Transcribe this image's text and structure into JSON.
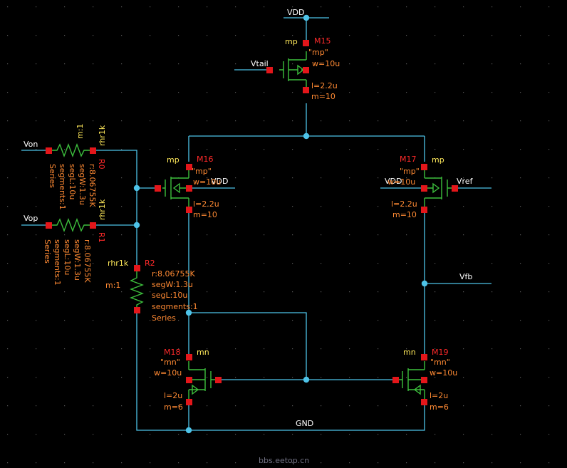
{
  "nets": {
    "vdd": "VDD",
    "vtail": "Vtail",
    "von": "Von",
    "vop": "Vop",
    "vref": "Vref",
    "vfb": "Vfb",
    "gnd": "GND",
    "vdd_m16": "VDD",
    "vdd_m17": "VDD"
  },
  "devices": {
    "m15": {
      "type": "mp",
      "name": "M15",
      "model": "\"mp\"",
      "w": "w=10u",
      "l": "l=2.2u",
      "m": "m=10"
    },
    "m16": {
      "type": "mp",
      "name": "M16",
      "model": "\"mp\"",
      "w": "w=10u",
      "l": "l=2.2u",
      "m": "m=10"
    },
    "m17": {
      "type": "mp",
      "name": "M17",
      "model": "\"mp\"",
      "w": "w=10u",
      "l": "l=2.2u",
      "m": "m=10"
    },
    "m18": {
      "type": "mn",
      "name": "M18",
      "model": "\"mn\"",
      "w": "w=10u",
      "l": "l=2u",
      "m": "m=6"
    },
    "m19": {
      "type": "mn",
      "name": "M19",
      "model": "\"mn\"",
      "w": "w=10u",
      "l": "l=2u",
      "m": "m=6"
    },
    "r0": {
      "cell": "rhr1k",
      "name": "R0",
      "mult": "m:1",
      "r": "r:8.06755K",
      "segW": "segW:1.3u",
      "segL": "segL:10u",
      "segments": "segments:1",
      "mode": "Series"
    },
    "r1": {
      "cell": "rhr1k",
      "name": "R1",
      "r": "r:8.06755K",
      "segW": "segW:1.3u",
      "segL": "segL:10u",
      "segments": "segments:1",
      "mode": "Series"
    },
    "r2": {
      "cell": "rhr1k",
      "name": "R2",
      "mult": "m:1",
      "r": "r:8.06755K",
      "segW": "segW:1.3u",
      "segL": "segL:10u",
      "segments": "segments:1",
      "mode": "Series"
    }
  },
  "watermark": "bbs.eetop.cn",
  "colors": {
    "background": "#000000",
    "wire": "#4ec3e8",
    "device": "#3dbf3d",
    "pin": "#e3161a",
    "instance": "#ff2a2a",
    "parameter": "#ff8a33",
    "cell": "#ffe95a"
  }
}
